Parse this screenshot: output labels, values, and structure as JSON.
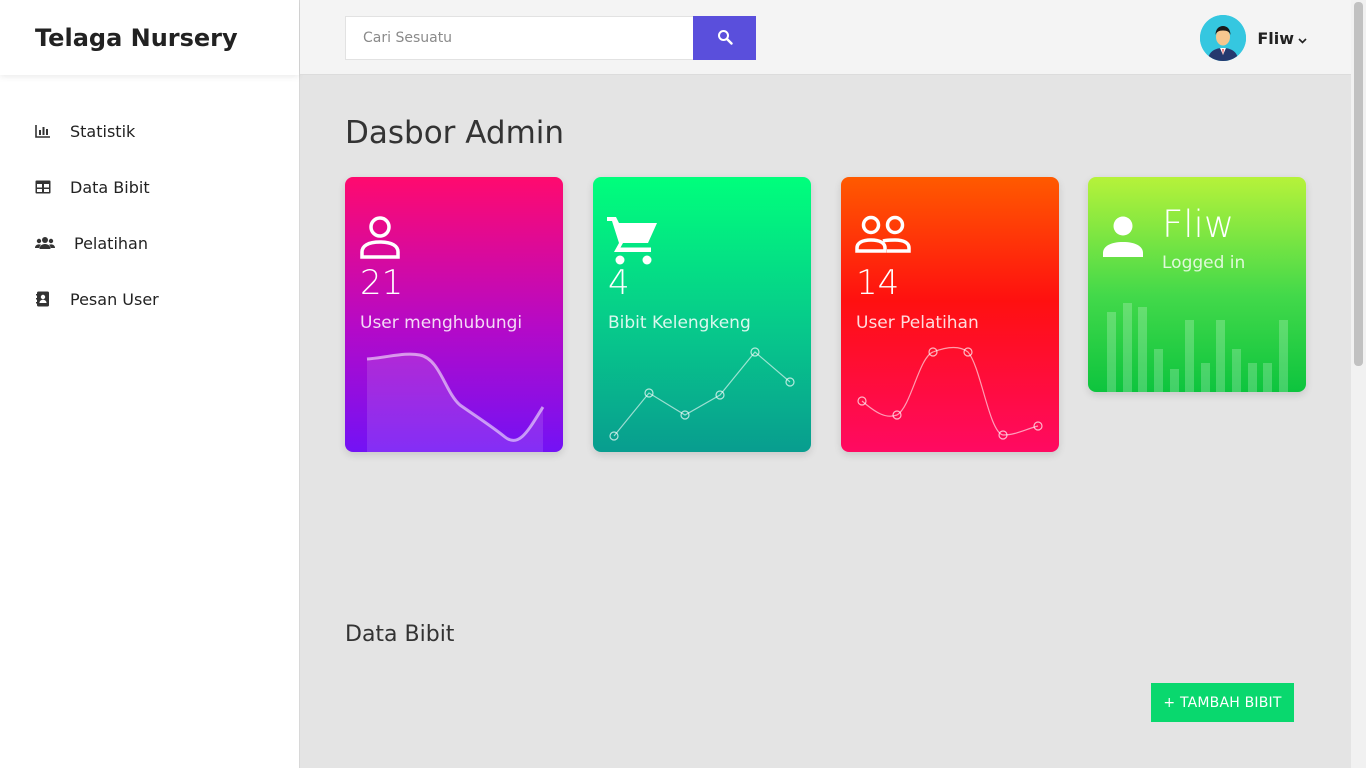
{
  "app": {
    "brand": "Telaga Nursery"
  },
  "sidebar": {
    "items": [
      {
        "label": "Statistik",
        "icon": "bar-chart-icon"
      },
      {
        "label": "Data Bibit",
        "icon": "table-icon"
      },
      {
        "label": "Pelatihan",
        "icon": "users-icon"
      },
      {
        "label": "Pesan User",
        "icon": "contact-book-icon"
      }
    ]
  },
  "topbar": {
    "search": {
      "placeholder": "Cari Sesuatu",
      "value": "",
      "icon": "search-icon"
    },
    "user": {
      "name": "Fliw",
      "icon": "chevron-down-icon"
    }
  },
  "main": {
    "title": "Dasbor Admin",
    "cards": [
      {
        "count": "21",
        "label": "User menghubungi",
        "icon": "user-icon"
      },
      {
        "count": "4",
        "label": "Bibit Kelengkeng",
        "icon": "cart-icon"
      },
      {
        "count": "14",
        "label": "User Pelatihan",
        "icon": "group-icon"
      },
      {
        "name": "Fliw",
        "status": "Logged in",
        "icon": "person-icon"
      }
    ],
    "section_title": "Data Bibit",
    "add_button": "+ TAMBAH BIBIT"
  },
  "colors": {
    "accent": "#5a4fdc",
    "card1": "#ff0a6e",
    "card2": "#00ff7c",
    "card3": "#ff1010",
    "card4": "#43d94a",
    "add_button": "#09d86e"
  }
}
